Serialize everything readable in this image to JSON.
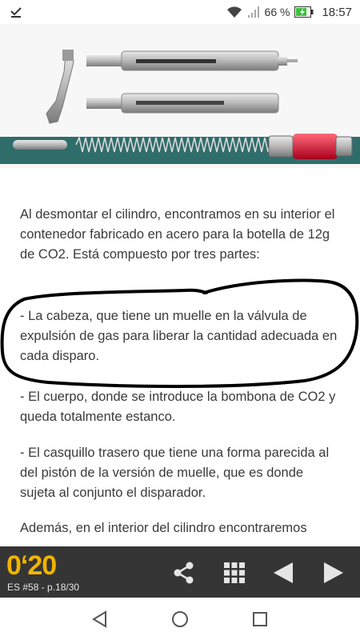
{
  "status_bar": {
    "battery_percent": "66 %",
    "time": "18:57"
  },
  "article": {
    "paragraphs": [
      "Al desmontar el cilindro, encontramos en su interior el contenedor fabricado en acero para la botella de 12g de CO2. Está compuesto por tres partes:",
      "- La cabeza, que tiene un muelle en la válvula de expulsión de gas para liberar la cantidad adecuada en cada disparo.",
      "- El cuerpo, donde se introduce la bombona de CO2 y queda totalmente estanco.",
      "- El casquillo trasero que tiene una forma parecida al del pistón de la versión de muelle, que es donde sujeta al conjunto el disparador.",
      "Además, en el interior del cilindro encontraremos"
    ]
  },
  "reader_toolbar": {
    "logo": "0‘20",
    "issue": "ES #58 - p.18/30"
  },
  "colors": {
    "toolbar_bg": "#353535",
    "logo_yellow": "#f0b400",
    "teal_strip": "#2f6d6a"
  }
}
